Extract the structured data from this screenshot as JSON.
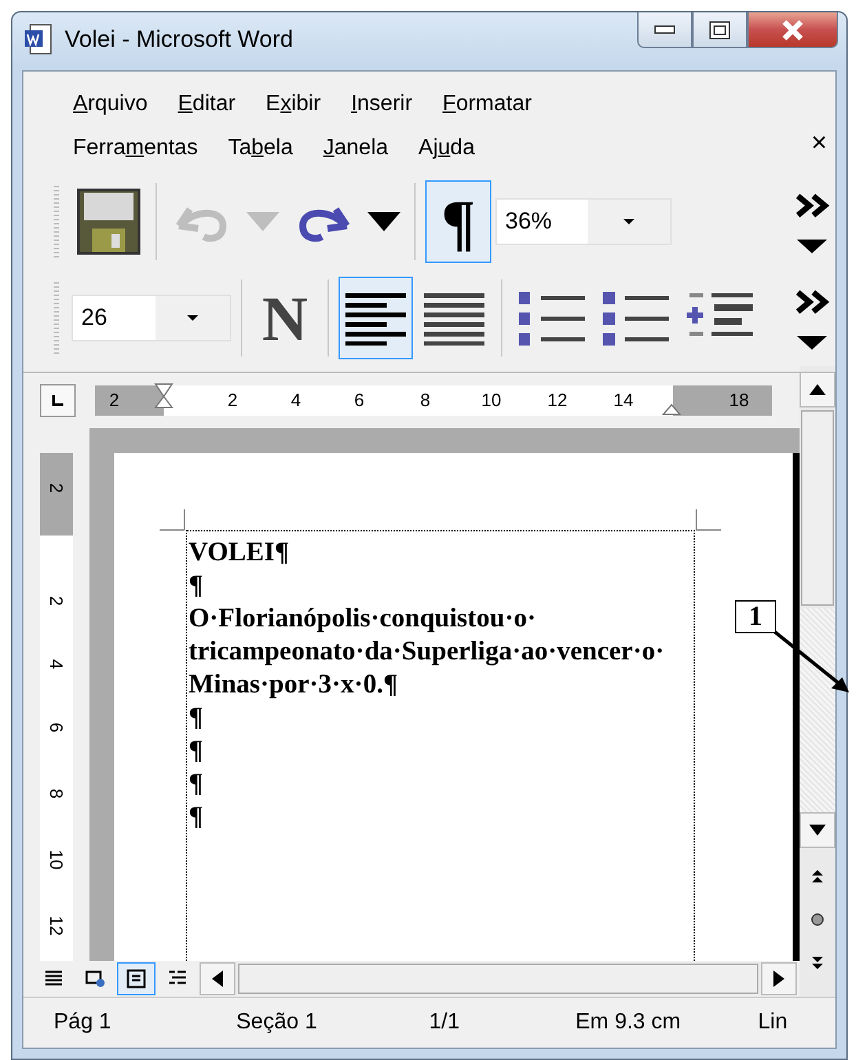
{
  "window": {
    "title": "Volei - Microsoft Word"
  },
  "menu": {
    "rows": [
      [
        {
          "key": "A",
          "after": "rquivo"
        },
        {
          "key": "E",
          "after": "ditar"
        },
        {
          "before": "E",
          "key": "x",
          "after": "ibir"
        },
        {
          "key": "I",
          "after": "nserir"
        },
        {
          "key": "F",
          "after": "ormatar"
        }
      ],
      [
        {
          "before": "Ferra",
          "key": "m",
          "after": "entas"
        },
        {
          "before": "Ta",
          "key": "b",
          "after": "ela"
        },
        {
          "key": "J",
          "after": "anela"
        },
        {
          "before": "Aj",
          "key": "u",
          "after": "da"
        }
      ]
    ],
    "close": "×"
  },
  "standard_toolbar": {
    "buttons": [
      {
        "kind": "save",
        "disabled": false,
        "pressed": false
      },
      {
        "kind": "undo",
        "disabled": true,
        "pressed": false
      },
      {
        "kind": "dropdown",
        "disabled": true,
        "pressed": false
      },
      {
        "kind": "redo",
        "disabled": false,
        "pressed": false
      },
      {
        "kind": "dropdown",
        "disabled": false,
        "pressed": false
      },
      {
        "kind": "text",
        "label": "¶",
        "disabled": false,
        "pressed": true
      }
    ],
    "zoom": "36%"
  },
  "formatting_toolbar": {
    "font_size": "26",
    "buttons": [
      {
        "kind": "text",
        "label": "N",
        "disabled": false,
        "pressed": false
      },
      {
        "kind": "align-left",
        "disabled": false,
        "pressed": true
      },
      {
        "kind": "justify",
        "disabled": false,
        "pressed": false
      },
      {
        "kind": "numbering",
        "disabled": false,
        "pressed": false
      },
      {
        "kind": "bullets",
        "disabled": false,
        "pressed": false
      },
      {
        "kind": "indent",
        "disabled": false,
        "pressed": false
      }
    ]
  },
  "ruler": {
    "labels": [
      "2",
      "2",
      "4",
      "6",
      "8",
      "10",
      "12",
      "14",
      "18"
    ]
  },
  "vertical_ruler": {
    "labels": [
      "2",
      "2",
      "4",
      "6",
      "8",
      "10",
      "12"
    ]
  },
  "document": {
    "paragraphs": [
      "VOLEI¶",
      "¶",
      "O·Florianópolis·conquistou·o·tricampeonato·da·Superliga·ao·vencer·o·Minas·por·3·x·0.¶",
      "¶",
      "¶",
      "¶",
      "¶"
    ]
  },
  "callout": {
    "label": "1"
  },
  "view_buttons": [
    {
      "selected": false
    },
    {
      "selected": false
    },
    {
      "selected": true
    },
    {
      "selected": false
    }
  ],
  "status_bar": [
    "Pág 1",
    "Seção 1",
    "1/1",
    "Em 9.3 cm",
    "Lin"
  ]
}
